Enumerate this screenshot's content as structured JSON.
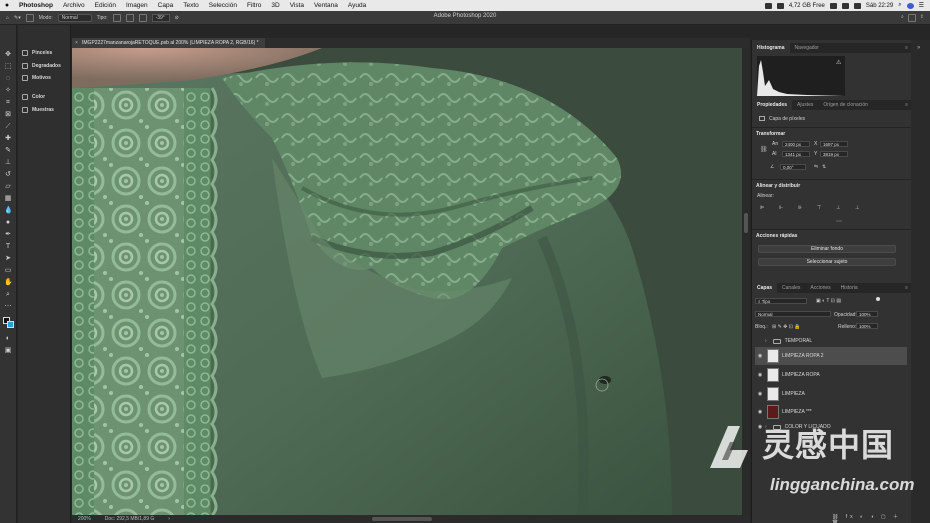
{
  "menubar": {
    "items": [
      "Photoshop",
      "Archivo",
      "Edición",
      "Imagen",
      "Capa",
      "Texto",
      "Selección",
      "Filtro",
      "3D",
      "Vista",
      "Ventana",
      "Ayuda"
    ],
    "storage": "4,72 GB Free",
    "clock": "Sáb 22:29"
  },
  "app_title": "Adobe Photoshop 2020",
  "options": {
    "mode_label": "Modo:",
    "mode_value": "Normal",
    "type_label": "Tipo:",
    "angle_value": "-39°"
  },
  "dock": [
    "Pinceles",
    "Degradados",
    "Motivos",
    "Color",
    "Muestras"
  ],
  "document": {
    "tab_title": "IMGP2227manzanarojaRETOQUE.psb al 200% (LIMPIEZA ROPA 2, RGB/16) *",
    "zoom": "200%",
    "doc_info": "Doc: 292,5 MB/1,89 G"
  },
  "histogram": {
    "tabs": [
      "Histograma",
      "Navegador"
    ]
  },
  "properties": {
    "tabs": [
      "Propiedades",
      "Ajustes",
      "Origen de clonación"
    ],
    "layer_kind": "Capa de píxeles",
    "transform_title": "Transformar",
    "w_label": "An",
    "w_value": "2400 px",
    "x_label": "X",
    "x_value": "1697 px",
    "h_label": "Al",
    "h_value": "1341 px",
    "y_label": "Y",
    "y_value": "3819 px",
    "rot_value": "0,00°",
    "align_title": "Alinear y distribuir",
    "align_label": "Alinear:",
    "quick_title": "Acciones rápidas",
    "btn_remove_bg": "Eliminar fondo",
    "btn_select_subject": "Seleccionar sujeto"
  },
  "layers_panel": {
    "tabs": [
      "Capas",
      "Canales",
      "Acciones",
      "Historia"
    ],
    "filter_value": "Tipo",
    "blend_value": "Normal",
    "opacity_label": "Opacidad:",
    "opacity_value": "100%",
    "lock_label": "Bloq.:",
    "fill_label": "Relleno:",
    "fill_value": "100%",
    "layers": [
      {
        "name": "TEMPORAL",
        "kind": "group"
      },
      {
        "name": "LIMPIEZA ROPA 2",
        "kind": "pixel",
        "selected": true
      },
      {
        "name": "LIMPIEZA ROPA",
        "kind": "pixel"
      },
      {
        "name": "LIMPIEZA",
        "kind": "pixel"
      },
      {
        "name": "LIMPIEZA ***",
        "kind": "pixel-dark"
      },
      {
        "name": "COLOR Y LICUADO",
        "kind": "group"
      }
    ]
  },
  "watermark": {
    "cn": "灵感中国",
    "en": "lingganchina.com"
  },
  "colors": {
    "fabric": "#5f7d63",
    "fabric_dark": "#3f5a44",
    "skin": "#b98f82",
    "lace": "#7fa583"
  }
}
